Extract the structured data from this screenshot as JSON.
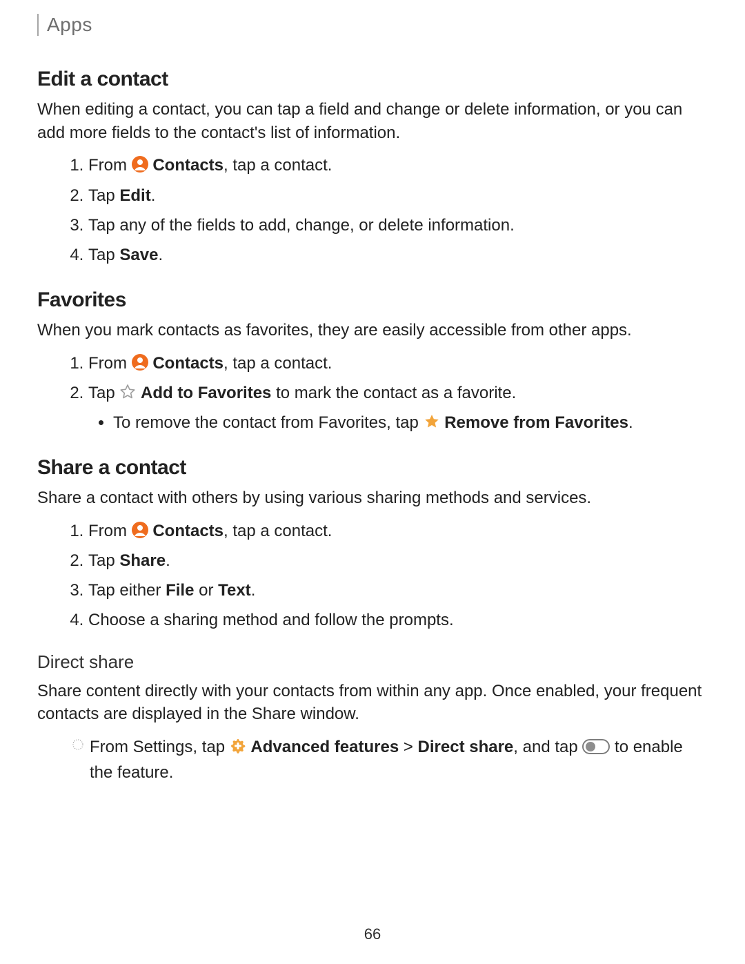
{
  "breadcrumb": "Apps",
  "page_number": "66",
  "icons": {
    "contacts_label": "Contacts",
    "star_outline_label": "Add to Favorites",
    "star_filled_label": "Remove from Favorites",
    "gear_label": "Advanced features"
  },
  "sections": {
    "edit": {
      "title": "Edit a contact",
      "intro": "When editing a contact, you can tap a field and change or delete information, or you can add more fields to the contact's list of information.",
      "step1_pre": "From ",
      "step1_bold": "Contacts",
      "step1_post": ", tap a contact.",
      "step2_pre": "Tap ",
      "step2_bold": "Edit",
      "step2_post": ".",
      "step3": "Tap any of the fields to add, change, or delete information.",
      "step4_pre": "Tap ",
      "step4_bold": "Save",
      "step4_post": "."
    },
    "favorites": {
      "title": "Favorites",
      "intro": "When you mark contacts as favorites, they are easily accessible from other apps.",
      "step1_pre": "From ",
      "step1_bold": "Contacts",
      "step1_post": ", tap a contact.",
      "step2_pre": "Tap ",
      "step2_bold": "Add to Favorites",
      "step2_post": " to mark the contact as a favorite.",
      "sub_pre": "To remove the contact from Favorites, tap ",
      "sub_bold": "Remove from Favorites",
      "sub_post": "."
    },
    "share": {
      "title": "Share a contact",
      "intro": "Share a contact with others by using various sharing methods and services.",
      "step1_pre": "From ",
      "step1_bold": "Contacts",
      "step1_post": ", tap a contact.",
      "step2_pre": "Tap ",
      "step2_bold": "Share",
      "step2_post": ".",
      "step3_pre": "Tap either ",
      "step3_bold1": "File",
      "step3_mid": " or ",
      "step3_bold2": "Text",
      "step3_post": ".",
      "step4": "Choose a sharing method and follow the prompts."
    },
    "direct_share": {
      "title": "Direct share",
      "intro": "Share content directly with your contacts from within any app. Once enabled, your frequent contacts are displayed in the Share window.",
      "step_pre": "From Settings, tap ",
      "step_bold1": "Advanced features",
      "step_mid1": " > ",
      "step_bold2": "Direct share",
      "step_mid2": ", and tap ",
      "step_post": " to enable the feature."
    }
  }
}
